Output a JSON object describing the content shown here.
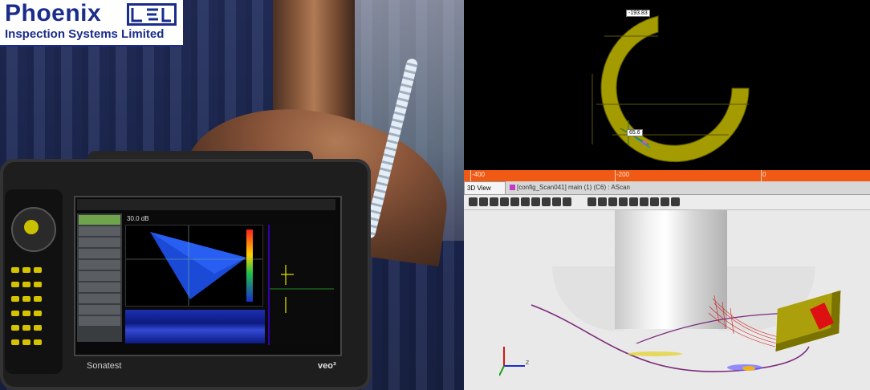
{
  "logo": {
    "name": "Phoenix",
    "subtitle": "Inspection Systems Limited"
  },
  "device": {
    "brand": "Sonatest",
    "model": "veo³",
    "screen": {
      "gain": "30.0 dB"
    }
  },
  "scan_plot": {
    "label_top": "-193.83",
    "label_mid": "65.6"
  },
  "axis": {
    "ticks": [
      "-400",
      "-200",
      "0"
    ]
  },
  "view3d": {
    "tabs": {
      "active": "3D View",
      "second": "[config_Scan041] main (1) (C6) : AScan"
    },
    "toolbar_count": 19,
    "axes": {
      "x": "X",
      "y": "Y",
      "z": "Z"
    }
  },
  "colors": {
    "orange_axis": "#f05a14",
    "wedge": "#aba00b",
    "scan_band": "#a39b00"
  }
}
